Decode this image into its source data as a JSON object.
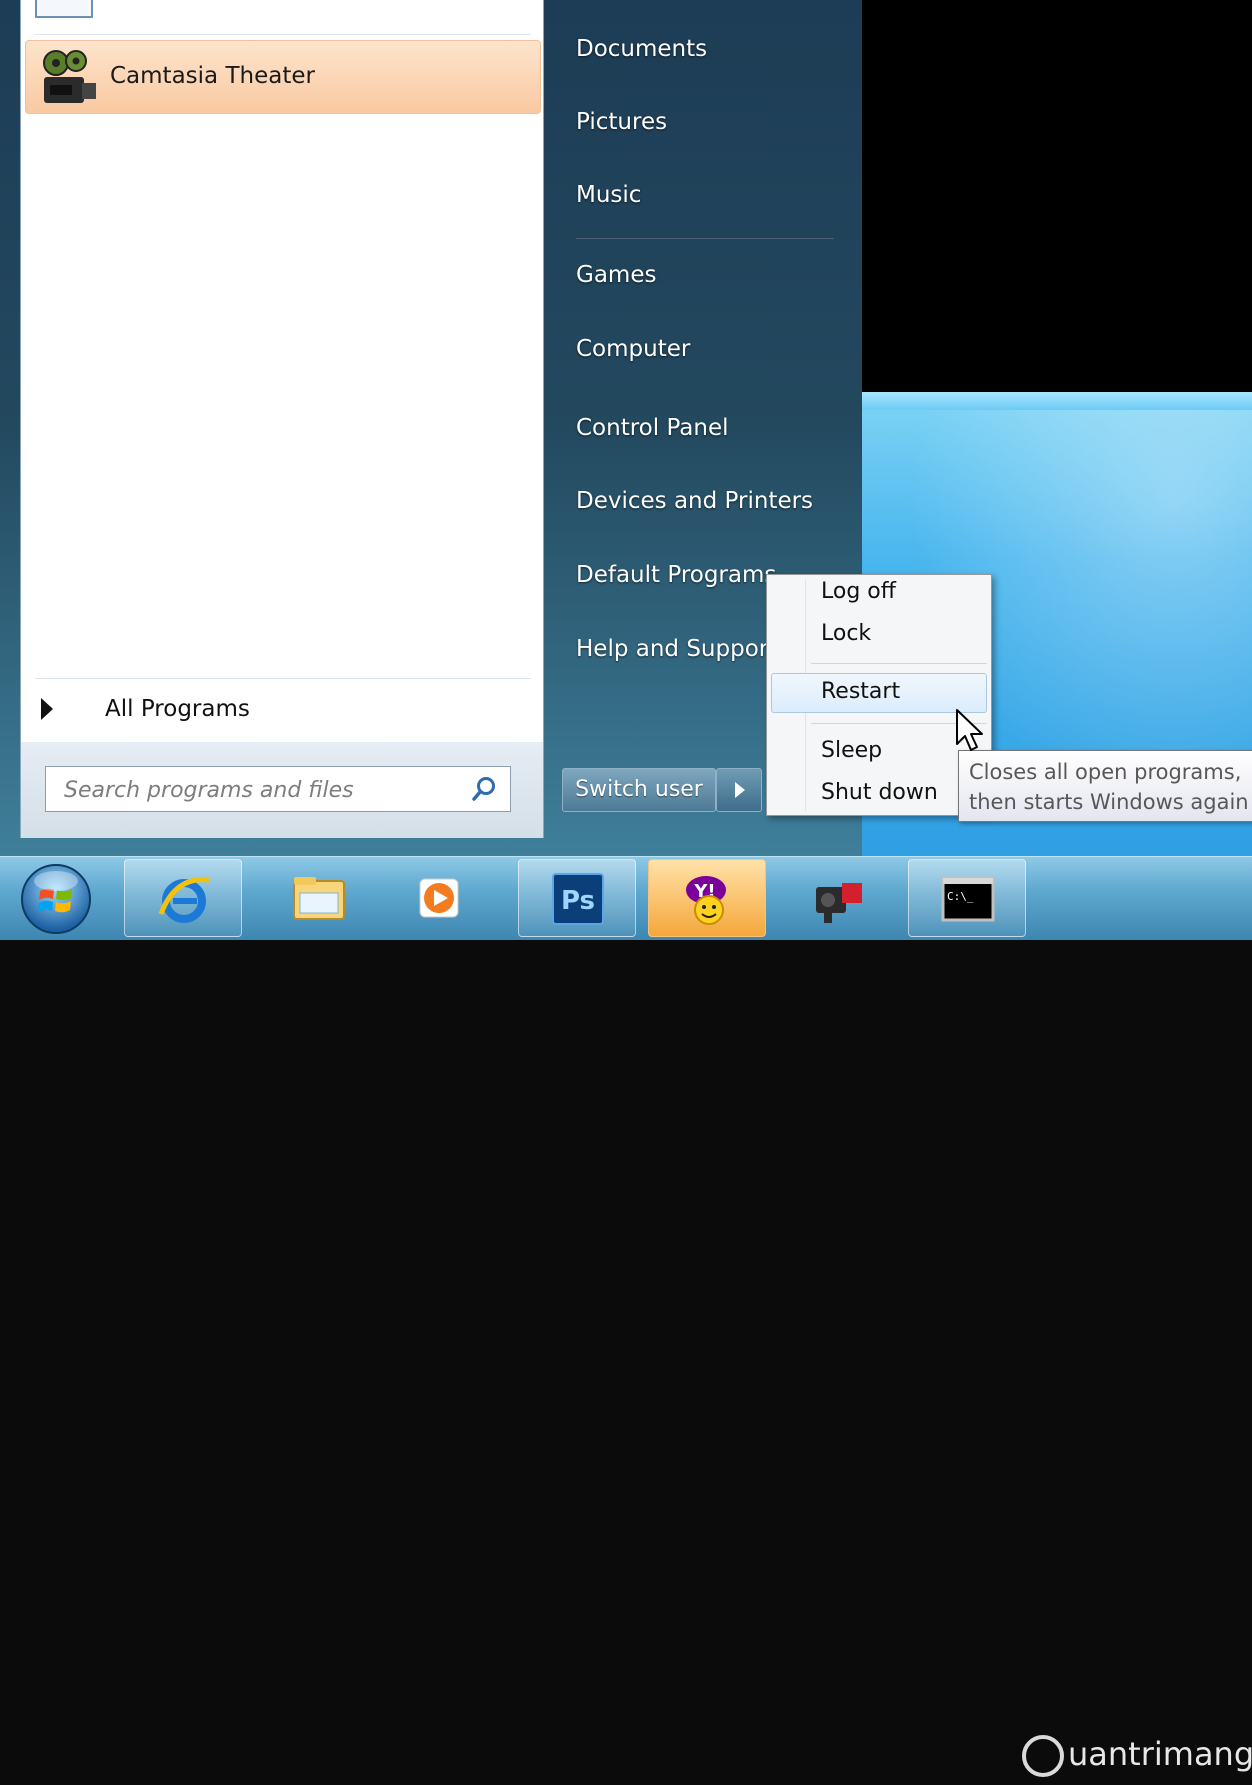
{
  "start_menu": {
    "pinned": {
      "label": "Camtasia Theater"
    },
    "all_programs": {
      "label": "All Programs"
    },
    "search": {
      "placeholder": "Search programs and files"
    },
    "right_items": [
      {
        "label": "Documents"
      },
      {
        "label": "Pictures"
      },
      {
        "label": "Music"
      },
      {
        "label": "Games"
      },
      {
        "label": "Computer"
      },
      {
        "label": "Control Panel"
      },
      {
        "label": "Devices and Printers"
      },
      {
        "label": "Default Programs"
      },
      {
        "label": "Help and Support"
      }
    ],
    "switch_user": {
      "label": "Switch user"
    }
  },
  "context_menu": {
    "items": [
      {
        "label": "Log off"
      },
      {
        "label": "Lock"
      },
      {
        "label": "Restart"
      },
      {
        "label": "Sleep"
      },
      {
        "label": "Shut down"
      }
    ],
    "highlighted": "Restart"
  },
  "tooltip": {
    "line1": "Closes all open programs,",
    "line2": "then starts Windows again"
  },
  "taskbar": {
    "buttons": [
      {
        "icon": "internet-explorer-icon"
      },
      {
        "icon": "windows-explorer-icon"
      },
      {
        "icon": "media-player-icon"
      },
      {
        "icon": "photoshop-icon",
        "text": "Ps"
      },
      {
        "icon": "yahoo-messenger-icon",
        "text": "Y!"
      },
      {
        "icon": "camtasia-recorder-icon"
      },
      {
        "icon": "command-prompt-icon",
        "text": "C:\\_"
      }
    ]
  },
  "watermark": {
    "text": "uantrimang"
  },
  "colors": {
    "accent_hover": "#fbd3b0",
    "taskbar": "#5fa8cf",
    "menu_dark": "#1d3c55"
  }
}
